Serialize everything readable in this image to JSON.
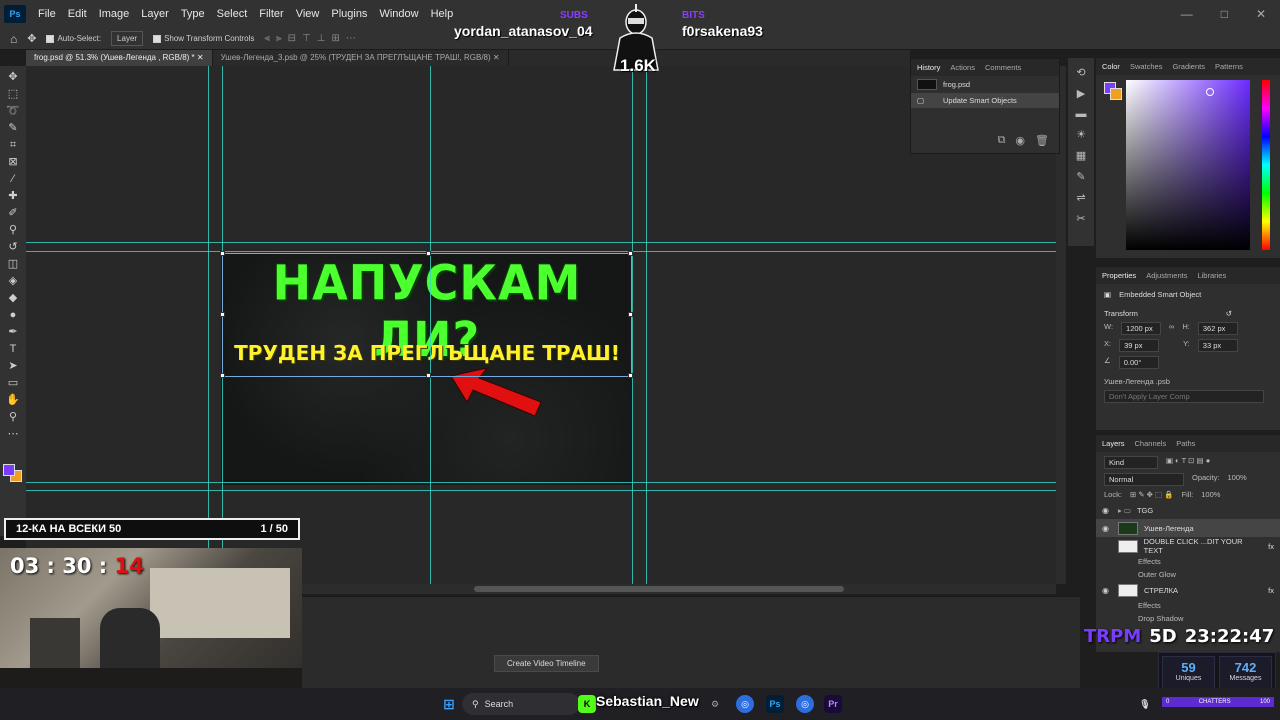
{
  "menu": {
    "logo": "Ps",
    "items": [
      "File",
      "Edit",
      "Image",
      "Layer",
      "Type",
      "Select",
      "Filter",
      "View",
      "Plugins",
      "Window",
      "Help"
    ],
    "window_controls": [
      "—",
      "□",
      "✕"
    ]
  },
  "options": {
    "auto_select": "Auto-Select:",
    "target": "Layer",
    "show_transform": "Show Transform Controls"
  },
  "stream_overlay": {
    "left_tag": "SUBS",
    "left_name": "yordan_atanasov_04",
    "right_tag": "BITS",
    "right_name": "f0rsakena93",
    "viewers": "1.6K",
    "handle": "Sebastian_New",
    "challenge": {
      "title": "12-КА НА ВСЕКИ 50",
      "progress": "1 / 50"
    },
    "timer": {
      "mm": "03",
      "ss": "30",
      "red": "14"
    },
    "clock": {
      "brand": "TRPM",
      "day": "5D",
      "time": "23:22:47"
    },
    "stats": {
      "uniques": "59",
      "uniques_label": "Uniques",
      "messages": "742",
      "messages_label": "Messages"
    },
    "chatters": {
      "left": "0",
      "label": "CHATTERS",
      "right": "100"
    }
  },
  "doc_tabs": [
    {
      "label": "frog.psd @ 51.3% (Ушев-Легенда , RGB/8) *  ✕",
      "active": true
    },
    {
      "label": "Ушев-Легенда_3.psb @ 25% (ТРУДЕН ЗА ПРЕГЛЪЩАНЕ ТРАШ!, RGB/8)  ✕",
      "active": false
    }
  ],
  "artboard": {
    "headline": "НАПУСКАМ ЛИ?",
    "subline": "ТРУДЕН ЗА ПРЕГЛЪЩАНЕ ТРАШ!",
    "headline_color": "#4cff2f",
    "subline_color": "#fff22a",
    "arrow_color": "#e01010"
  },
  "history": {
    "tabs": [
      "History",
      "Actions",
      "Comments"
    ],
    "rows": [
      "frog.psd",
      "Update Smart Objects"
    ]
  },
  "color_panel": {
    "tabs": [
      "Color",
      "Swatches",
      "Gradients",
      "Patterns"
    ]
  },
  "properties": {
    "tabs": [
      "Properties",
      "Adjustments",
      "Libraries"
    ],
    "type": "Embedded Smart Object",
    "section": "Transform",
    "w_label": "W:",
    "w": "1200 px",
    "h_label": "H:",
    "h": "362 px",
    "x_label": "X:",
    "x": "39 px",
    "y_label": "Y:",
    "y": "33 px",
    "angle": "0.00°",
    "file": "Ушев-Легенда .psb",
    "comp": "Don't Apply Layer Comp"
  },
  "layers": {
    "tabs": [
      "Layers",
      "Channels",
      "Paths"
    ],
    "kind": "Kind",
    "blend": "Normal",
    "opacity_label": "Opacity:",
    "opacity": "100%",
    "lock_label": "Lock:",
    "fill_label": "Fill:",
    "fill": "100%",
    "group": "TGG",
    "rows": [
      {
        "name": "Ушев-Легенда",
        "selected": true
      },
      {
        "name": "DOUBLE CLICK ...DIT YOUR TEXT",
        "selected": false,
        "fx": "fx"
      },
      {
        "name": "Effects",
        "sub": true
      },
      {
        "name": "Outer Glow",
        "sub": true
      },
      {
        "name": "СТРЕЛКА",
        "selected": false,
        "fx": "fx"
      },
      {
        "name": "Effects",
        "sub": true
      },
      {
        "name": "Drop Shadow",
        "sub": true
      }
    ]
  },
  "timeline": {
    "button": "Create Video Timeline"
  },
  "taskbar": {
    "search": "Search"
  }
}
